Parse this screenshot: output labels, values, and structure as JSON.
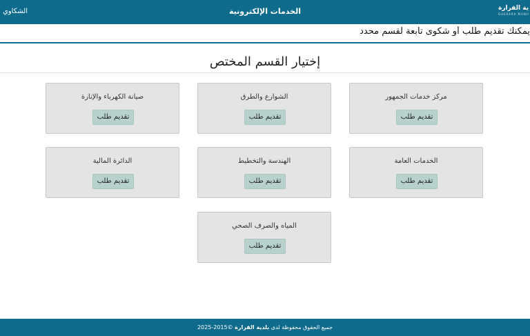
{
  "header": {
    "logo_ar": "بلدية القرارة",
    "logo_en": "GUERARA MUNICIPALITY",
    "title": "الخدمات الإلكترونية",
    "left_link": "الشكاوي"
  },
  "intro": {
    "text": "يمكنك تقديم طلب أو شكوى تابعة لقسم محدد"
  },
  "section": {
    "title": "إختيار القسم المختص"
  },
  "departments": [
    {
      "name": "مركز خدمات الجمهور",
      "button": "تقديم طلب"
    },
    {
      "name": "الشوارع والطرق",
      "button": "تقديم طلب"
    },
    {
      "name": "صيانة الكهرباء والإنارة",
      "button": "تقديم طلب"
    },
    {
      "name": "الخدمات العامة",
      "button": "تقديم طلب"
    },
    {
      "name": "الهندسة والتخطيط",
      "button": "تقديم طلب"
    },
    {
      "name": "الدائرة المالية",
      "button": "تقديم طلب"
    },
    {
      "name": "المياه والصرف الصحي",
      "button": "تقديم طلب"
    }
  ],
  "footer": {
    "prefix": "جميع الحقوق محفوظة لدى",
    "org": "بلدية القرارة",
    "years": "©2015-2025"
  },
  "colors": {
    "brand": "#0f6b8c",
    "card_bg": "#e4e4e4",
    "button_bg": "#b7d2cc"
  }
}
